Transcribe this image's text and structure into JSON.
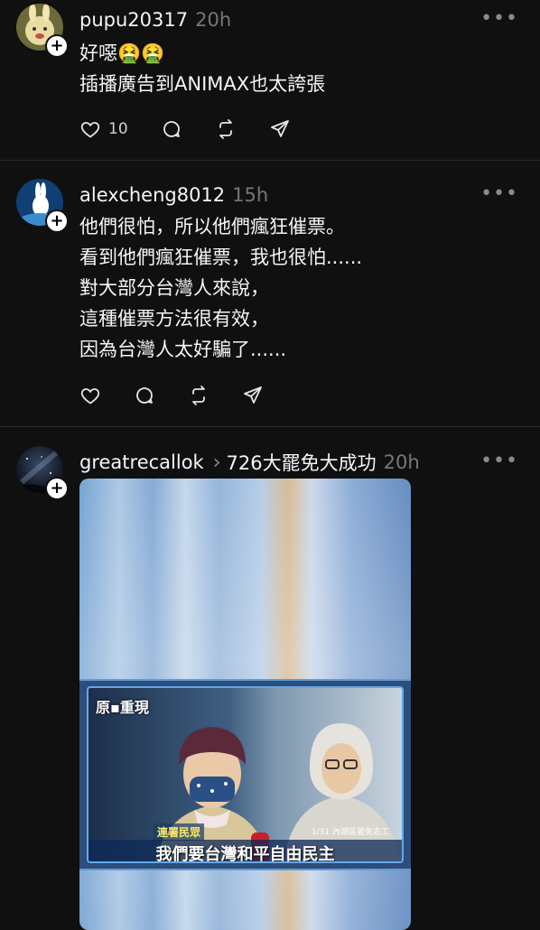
{
  "posts": [
    {
      "username": "pupu20317",
      "time": "20h",
      "lines": [
        "好噁🤮🤮",
        "插播廣告到ANIMAX也太誇張"
      ],
      "likes": "10",
      "avatar_icon": "rabbit-cartoon-avatar"
    },
    {
      "username": "alexcheng8012",
      "time": "15h",
      "lines": [
        "他們很怕，所以他們瘋狂催票。",
        "看到他們瘋狂催票，我也很怕......",
        "對大部分台灣人來說，",
        "這種催票方法很有效，",
        "因為台灣人太好騙了......"
      ],
      "avatar_icon": "white-rabbit-avatar"
    },
    {
      "username": "greatrecallok",
      "topic": "726大罷免大成功",
      "time": "20h",
      "avatar_icon": "night-sky-avatar",
      "image": {
        "logo": "原▪︎重現",
        "name_caption": "連署民眾",
        "date_caption": "1/31 內湖區罷免志工",
        "main_caption": "我們要台灣和平自由民主"
      }
    }
  ],
  "ui": {
    "more_symbol": "•••",
    "plus_symbol": "+"
  },
  "colors": {
    "background": "#101010",
    "text": "#f3f5f7",
    "muted": "#777777",
    "divider": "#2a2a2a"
  }
}
